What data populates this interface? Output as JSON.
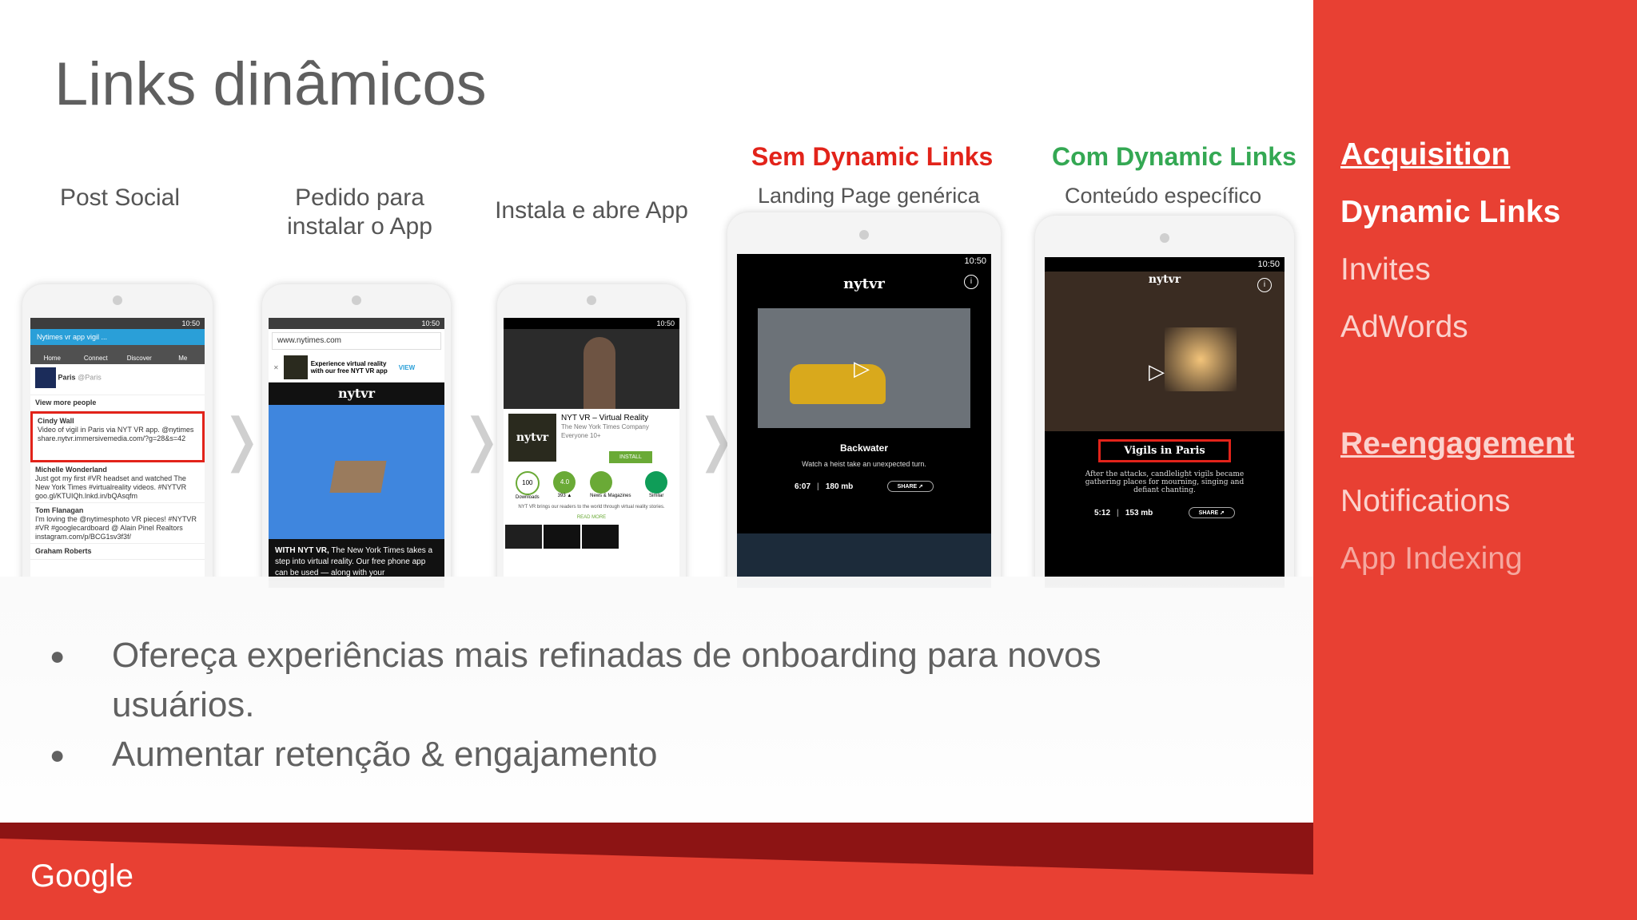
{
  "title": "Links dinâmicos",
  "steps": [
    {
      "label": "Post Social"
    },
    {
      "label": "Pedido para instalar o App"
    },
    {
      "label": "Instala e abre App"
    }
  ],
  "without": {
    "heading": "Sem Dynamic Links",
    "sub": "Landing Page genérica"
  },
  "with": {
    "heading": "Com Dynamic Links",
    "sub": "Conteúdo específico"
  },
  "phone": {
    "time": "10:50"
  },
  "twitter": {
    "search": "Nytimes vr app vigil ...",
    "tabs": [
      "Home",
      "Connect",
      "Discover",
      "Me"
    ],
    "account": "Paris",
    "handle": "@Paris",
    "more": "View more people",
    "tweets": [
      {
        "name": "Cindy Wall",
        "text": "Video of vigil in Paris via NYT VR app. @nytimes share.nytvr.immersivemedia.com/?g=28&s=42"
      },
      {
        "name": "Michelle Wonderland",
        "text": "Just got my first #VR headset and watched The New York Times #virtualreality videos. #NYTVR goo.gl/KTUIQh.lnkd.in/bQAsqfm"
      },
      {
        "name": "Tom Flanagan",
        "text": "I'm loving the @nytimesphoto VR pieces! #NYTVR #VR #googlecardboard @ Alain Pinel Realtors instagram.com/p/BCG1sv3f3f/"
      },
      {
        "name": "Graham Roberts",
        "text": ""
      }
    ]
  },
  "browser": {
    "url": "www.nytimes.com",
    "banner": "Experience virtual reality with our free NYT VR app",
    "view": "VIEW",
    "brand": "nytvr",
    "caption_bold": "WITH NYT VR,",
    "caption": " The New York Times takes a step into virtual reality. Our free phone app can be used — along with your"
  },
  "store": {
    "app_name": "NYT VR – Virtual Reality",
    "publisher": "The New York Times Company",
    "rating": "Everyone 10+",
    "install": "INSTALL",
    "stats": [
      "100",
      "4.0",
      "",
      ""
    ],
    "stat_labels": [
      "Downloads",
      "393 ▲",
      "News & Magazines",
      "Similar"
    ],
    "desc": "NYT VR brings our readers to the world through virtual reality stories.",
    "read_more": "READ MORE"
  },
  "generic": {
    "title": "Backwater",
    "desc": "Watch a heist take an unexpected turn.",
    "duration": "6:07",
    "size": "180 mb",
    "share": "SHARE"
  },
  "specific": {
    "title": "Vigils in Paris",
    "desc": "After the attacks, candlelight vigils became gathering places for mourning, singing and defiant chanting.",
    "duration": "5:12",
    "size": "153 mb",
    "share": "SHARE"
  },
  "bullets": [
    "Ofereça experiências mais refinadas de onboarding para novos usuários.",
    "Aumentar retenção & engajamento"
  ],
  "sidebar": {
    "acquisition": "Acquisition",
    "dynamic_links": "Dynamic Links",
    "invites": "Invites",
    "adwords": "AdWords",
    "reengagement": "Re-engagement",
    "notifications": "Notifications",
    "app_indexing": "App Indexing"
  },
  "logo": "Google",
  "colors": {
    "accent_red": "#e84033",
    "heading_red": "#e2231a",
    "heading_green": "#34a853",
    "footer_dark": "#8d1414"
  }
}
